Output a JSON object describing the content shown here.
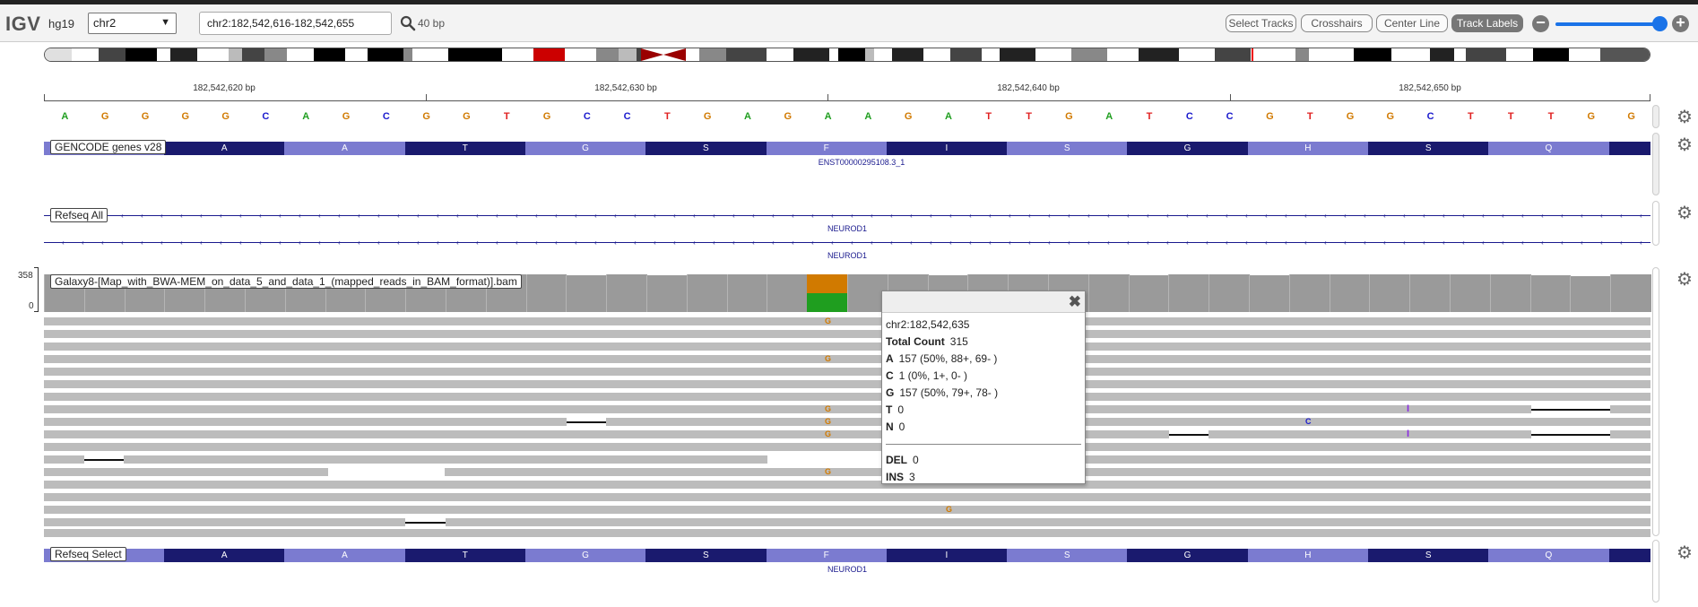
{
  "app": {
    "logo": "IGV",
    "genome": "hg19"
  },
  "toolbar": {
    "chromosome": "chr2",
    "locus": "chr2:182,542,616-182,542,655",
    "window_size": "40 bp",
    "buttons": [
      "Select Tracks",
      "Crosshairs",
      "Center Line",
      "Track Labels"
    ],
    "active_button": "Track Labels",
    "zoom_level": 0.9
  },
  "ruler": {
    "ticks": [
      "182,542,620 bp",
      "182,542,630 bp",
      "182,542,640 bp",
      "182,542,650 bp"
    ]
  },
  "sequence": [
    "A",
    "G",
    "G",
    "G",
    "G",
    "C",
    "A",
    "G",
    "C",
    "G",
    "G",
    "T",
    "G",
    "C",
    "C",
    "T",
    "G",
    "A",
    "G",
    "A",
    "A",
    "G",
    "A",
    "T",
    "T",
    "G",
    "A",
    "T",
    "C",
    "C",
    "G",
    "T",
    "G",
    "G",
    "C",
    "T",
    "T",
    "T",
    "G",
    "G"
  ],
  "colors": {
    "A": "#1f9e1f",
    "C": "#1a1acd",
    "G": "#d17a00",
    "T": "#e02020",
    "gene_dark": "#1a1a6e",
    "gene_light": "#7b7bd0",
    "coverage": "#9a9a9a",
    "read": "#bcbcbc"
  },
  "tracks": {
    "gencode": {
      "label": "GENCODE genes v28",
      "amino_acids": [
        "A",
        "A",
        "T",
        "G",
        "S",
        "F",
        "I",
        "S",
        "G",
        "H",
        "S",
        "Q"
      ],
      "transcript": "ENST00000295108.3_1"
    },
    "refseq_all": {
      "label": "Refseq All",
      "gene_names": [
        "NEUROD1",
        "NEUROD1"
      ]
    },
    "alignment": {
      "label": "Galaxy8-[Map_with_BWA-MEM_on_data_5_and_data_1_(mapped_reads_in_BAM_format)].bam",
      "scale_max": "358",
      "scale_min": "0"
    },
    "refseq_select": {
      "label": "Refseq Select",
      "amino_acids": [
        "A",
        "A",
        "T",
        "G",
        "S",
        "F",
        "I",
        "S",
        "G",
        "H",
        "S",
        "Q"
      ],
      "gene_name": "NEUROD1"
    }
  },
  "popup": {
    "position": "chr2:182,542,635",
    "total_count_label": "Total Count",
    "total_count": "315",
    "bases": [
      {
        "base": "A",
        "value": "157 (50%, 88+, 69- )"
      },
      {
        "base": "C",
        "value": "1 (0%, 1+, 0- )"
      },
      {
        "base": "G",
        "value": "157 (50%, 79+, 78- )"
      },
      {
        "base": "T",
        "value": "0"
      },
      {
        "base": "N",
        "value": "0"
      }
    ],
    "del_label": "DEL",
    "del_value": "0",
    "ins_label": "INS",
    "ins_value": "3"
  },
  "icons": {
    "search": "search-icon",
    "settings": "gear-icon",
    "close": "close-icon",
    "zoom_in": "plus-icon",
    "zoom_out": "minus-icon"
  }
}
